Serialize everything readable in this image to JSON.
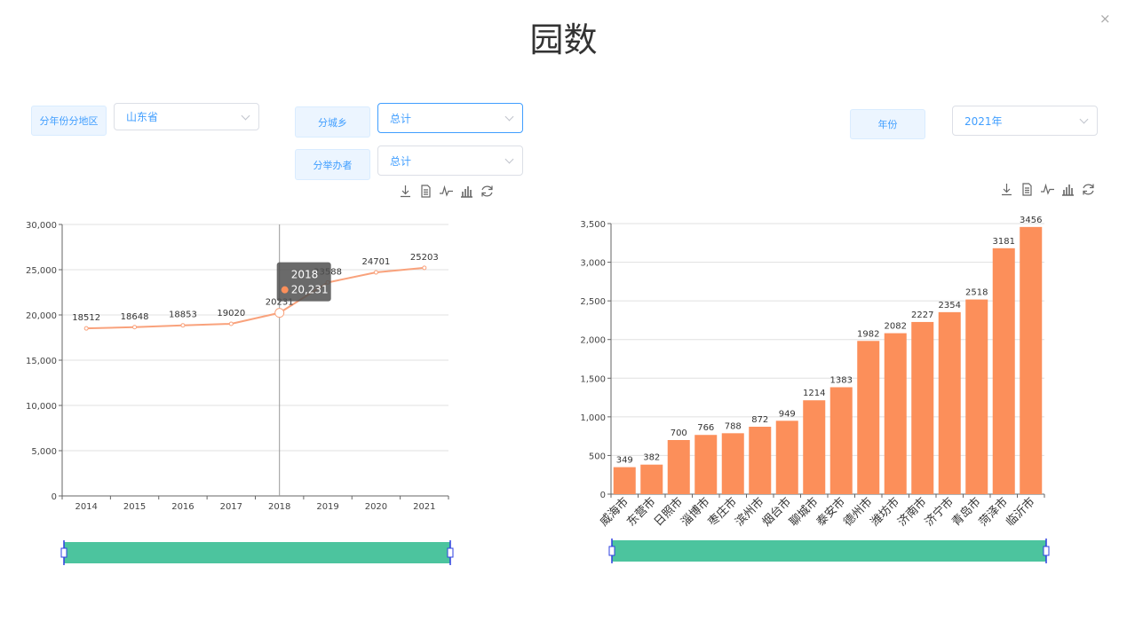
{
  "page": {
    "title": "园数",
    "close_glyph": "×"
  },
  "left_filters": {
    "region_label": "分年份分地区",
    "region_value": "山东省",
    "urban_label": "分城乡",
    "urban_value": "总计",
    "sponsor_label": "分举办者",
    "sponsor_value": "总计"
  },
  "right_filters": {
    "year_label": "年份",
    "year_value": "2021年"
  },
  "toolbox_icons": [
    "download-icon",
    "data-view-icon",
    "line-switch-icon",
    "bar-switch-icon",
    "restore-icon"
  ],
  "colors": {
    "series": "#fc8f5a",
    "line": "#f9a27c",
    "slider": "#4cc49e",
    "handle": "#2d3fe0"
  },
  "chart_data": [
    {
      "type": "line",
      "categories": [
        "2014",
        "2015",
        "2016",
        "2017",
        "2018",
        "2019",
        "2020",
        "2021"
      ],
      "values": [
        18512,
        18648,
        18853,
        19020,
        20231,
        23588,
        24701,
        25203
      ],
      "ylim": [
        0,
        30000
      ],
      "yticks": [
        "0",
        "5,000",
        "10,000",
        "15,000",
        "20,000",
        "25,000",
        "30,000"
      ],
      "tooltip": {
        "title": "2018",
        "value": "20,231"
      }
    },
    {
      "type": "bar",
      "categories": [
        "威海市",
        "东营市",
        "日照市",
        "淄博市",
        "枣庄市",
        "滨州市",
        "烟台市",
        "聊城市",
        "泰安市",
        "德州市",
        "潍坊市",
        "济南市",
        "济宁市",
        "青岛市",
        "菏泽市",
        "临沂市"
      ],
      "values": [
        349,
        382,
        700,
        766,
        788,
        872,
        949,
        1214,
        1383,
        1982,
        2082,
        2227,
        2354,
        2518,
        3181,
        3456
      ],
      "ylim": [
        0,
        3500
      ],
      "yticks": [
        "0",
        "500",
        "1,000",
        "1,500",
        "2,000",
        "2,500",
        "3,000",
        "3,500"
      ]
    }
  ]
}
